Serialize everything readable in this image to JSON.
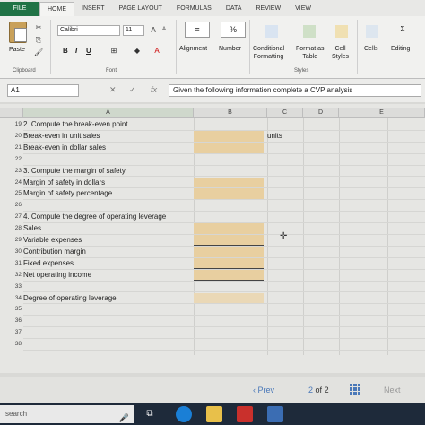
{
  "ribbon_tabs": [
    "FILE",
    "HOME",
    "INSERT",
    "PAGE LAYOUT",
    "FORMULAS",
    "DATA",
    "REVIEW",
    "VIEW"
  ],
  "ribbon": {
    "paste_label": "Paste",
    "clipboard_label": "Clipboard",
    "font_name": "Calibri",
    "font_size": "11",
    "font_label": "Font",
    "bold": "B",
    "italic": "I",
    "underline": "U",
    "alignment_label": "Alignment",
    "number_label": "Number",
    "number_icon": "%",
    "conditional_formatting_label": "Conditional\nFormatting",
    "format_as_table_label": "Format as\nTable",
    "cell_styles_label": "Cell\nStyles",
    "styles_label": "Styles",
    "cells_label": "Cells",
    "editing_label": "Editing"
  },
  "formula_bar": {
    "name_box": "A1",
    "fx": "fx",
    "formula": "Given the following information complete a CVP analysis"
  },
  "columns": [
    "A",
    "B",
    "C",
    "D",
    "E"
  ],
  "rows": [
    {
      "num": "19",
      "a": "2. Compute the break-even point",
      "b": "",
      "c": ""
    },
    {
      "num": "20",
      "a": "Break-even in unit sales",
      "b": "fill",
      "c": "units"
    },
    {
      "num": "21",
      "a": "Break-even in dollar sales",
      "b": "fill",
      "c": ""
    },
    {
      "num": "22",
      "a": "",
      "b": "",
      "c": ""
    },
    {
      "num": "23",
      "a": "3. Compute the margin of safety",
      "b": "",
      "c": ""
    },
    {
      "num": "24",
      "a": "Margin of safety in dollars",
      "b": "fill",
      "c": ""
    },
    {
      "num": "25",
      "a": "Margin of safety percentage",
      "b": "fill",
      "c": ""
    },
    {
      "num": "26",
      "a": "",
      "b": "",
      "c": ""
    },
    {
      "num": "27",
      "a": "4. Compute the degree of operating leverage",
      "b": "",
      "c": ""
    },
    {
      "num": "28",
      "a": "Sales",
      "b": "fill",
      "c": ""
    },
    {
      "num": "29",
      "a": "Variable expenses",
      "b": "fill-uline",
      "c": ""
    },
    {
      "num": "30",
      "a": "Contribution margin",
      "b": "fill",
      "c": ""
    },
    {
      "num": "31",
      "a": "Fixed expenses",
      "b": "fill-uline",
      "c": ""
    },
    {
      "num": "32",
      "a": "Net operating income",
      "b": "fill-uline",
      "c": ""
    },
    {
      "num": "33",
      "a": "",
      "b": "",
      "c": ""
    },
    {
      "num": "34",
      "a": "Degree of operating leverage",
      "b": "fill-light",
      "c": ""
    },
    {
      "num": "35",
      "a": "",
      "b": "",
      "c": ""
    },
    {
      "num": "36",
      "a": "",
      "b": "",
      "c": ""
    },
    {
      "num": "37",
      "a": "",
      "b": "",
      "c": ""
    },
    {
      "num": "38",
      "a": "",
      "b": "",
      "c": ""
    }
  ],
  "sheet_nav": {
    "prev": "Prev",
    "page_current": "2",
    "page_of": "of",
    "page_total": "2",
    "next": "Next"
  },
  "taskbar": {
    "search_placeholder": "search"
  }
}
